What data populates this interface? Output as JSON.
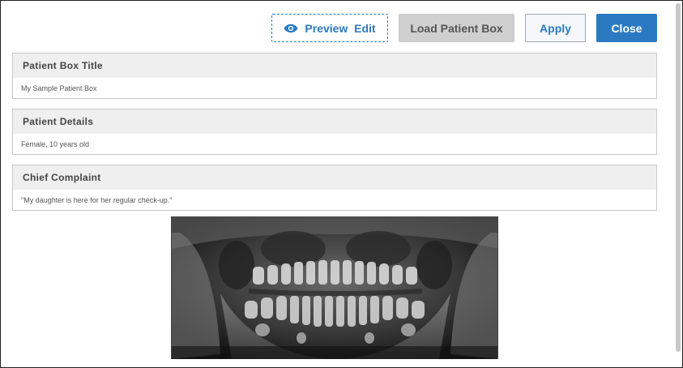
{
  "toolbar": {
    "preview_edit_label": "Preview  Edit",
    "load_label": "Load Patient Box",
    "apply_label": "Apply",
    "close_label": "Close"
  },
  "sections": [
    {
      "title": "Patient Box Title",
      "value": "My Sample Patient Box"
    },
    {
      "title": "Patient Details",
      "value": "Female, 10 years old"
    },
    {
      "title": "Chief Complaint",
      "value": "\"My daughter is here for her regular check-up.\""
    }
  ],
  "colors": {
    "accent": "#2b7ac1",
    "header_bg": "#efefef",
    "disabled_bg": "#d0d0d0"
  },
  "icons": {
    "preview": "eye-icon"
  },
  "image": {
    "kind": "panoramic dental x-ray"
  }
}
